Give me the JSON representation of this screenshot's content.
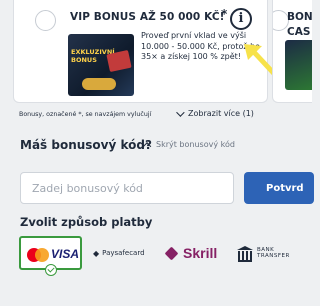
{
  "bonus_card": {
    "title": "VIP BONUS AŽ 50 000 KČ!",
    "star": "*",
    "info_glyph": "i",
    "image_tag": "EXKLUZIVNÍ BONUS",
    "description": "Proveď první vklad ve výši 10.000 - 50.000 Kč, protož ho 35× a získej 100 % zpět!"
  },
  "next_card": {
    "title_line1": "BON",
    "title_line2": "CAS"
  },
  "terms": {
    "note": "Bonusy, označené *, se navzájem vylučují",
    "show_more": "Zobrazit více (1)"
  },
  "promo": {
    "heading": "Máš bonusový kód?",
    "toggle_label": "Skrýt bonusový kód",
    "input_placeholder": "Zadej bonusový kód",
    "input_value": "",
    "apply_label": "Potvrd"
  },
  "payment": {
    "heading": "Zvolit způsob platby",
    "methods": [
      {
        "name": "VISA",
        "selected": true
      },
      {
        "name": "Paysafecard",
        "selected": false
      },
      {
        "name": "Skrill",
        "selected": false
      },
      {
        "name": "BANK TRANSFER",
        "label_line1": "BANK",
        "label_line2": "TRANSFER",
        "selected": false
      }
    ]
  },
  "colors": {
    "accent_blue": "#2d63b6",
    "selected_green": "#3a9a3e",
    "skrill_purple": "#862165",
    "annotation_yellow": "#f7e24a"
  },
  "icons": [
    "info-icon",
    "chevron-down-icon",
    "chevron-up-icon",
    "checkmark-icon",
    "mastercard-icon",
    "bank-icon",
    "skrill-icon",
    "paysafecard-icon"
  ]
}
